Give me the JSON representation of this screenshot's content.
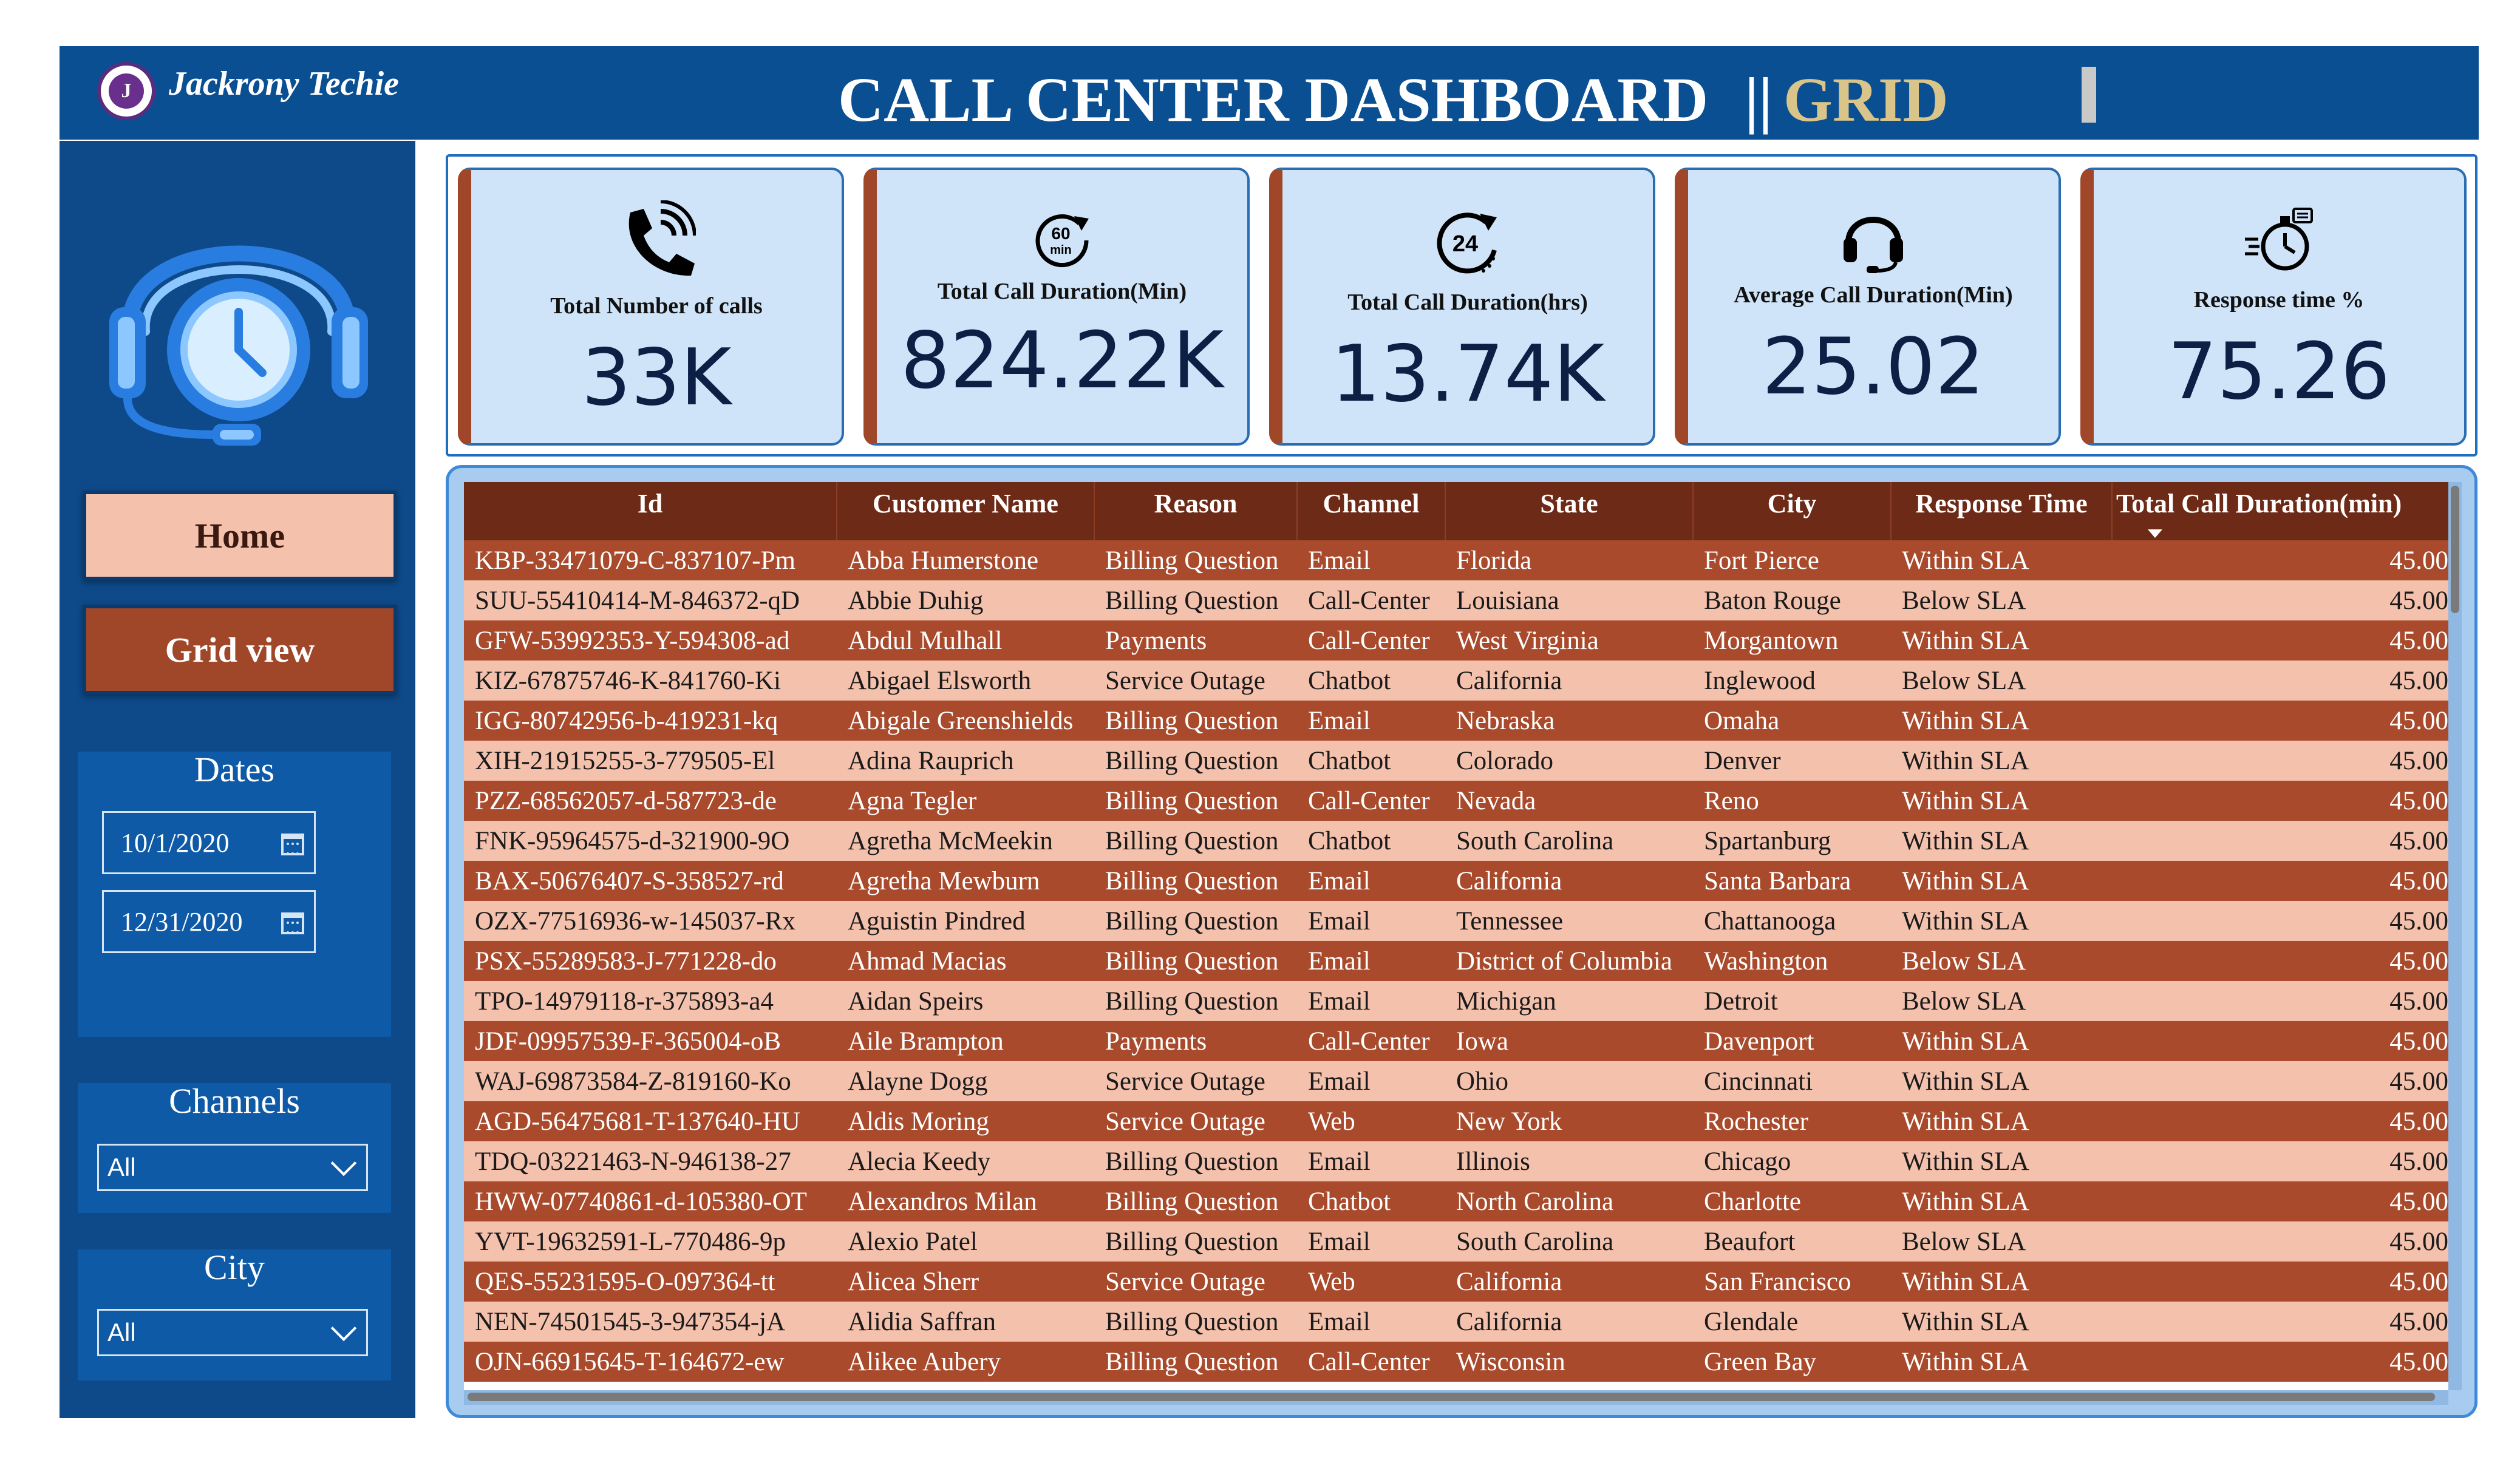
{
  "header": {
    "brand": "Jackrony Techie",
    "logo_letter": "J",
    "title": "CALL CENTER DASHBOARD",
    "separator": "||",
    "subtitle": "GRID"
  },
  "sidebar": {
    "nav": {
      "home_label": "Home",
      "grid_label": "Grid view"
    },
    "dates": {
      "title": "Dates",
      "start": "10/1/2020",
      "end": "12/31/2020"
    },
    "channels": {
      "title": "Channels",
      "value": "All"
    },
    "city": {
      "title": "City",
      "value": "All"
    }
  },
  "kpis": [
    {
      "label": "Total Number of calls",
      "value": "33K",
      "icon": "phone-ringing-icon"
    },
    {
      "label": "Total Call Duration(Min)",
      "value": "824.22K",
      "icon": "sixty-min-timer-icon"
    },
    {
      "label": "Total Call Duration(hrs)",
      "value": "13.74K",
      "icon": "twenty-four-hour-icon"
    },
    {
      "label": "Average Call Duration(Min)",
      "value": "25.02",
      "icon": "headset-icon"
    },
    {
      "label": "Response time %",
      "value": "75.26",
      "icon": "stopwatch-icon"
    }
  ],
  "table": {
    "columns": [
      "Id",
      "Customer Name",
      "Reason",
      "Channel",
      "State",
      "City",
      "Response Time",
      "Total Call Duration(min)"
    ],
    "rows": [
      [
        "KBP-33471079-C-837107-Pm",
        "Abba Humerstone",
        "Billing Question",
        "Email",
        "Florida",
        "Fort Pierce",
        "Within SLA",
        "45.00"
      ],
      [
        "SUU-55410414-M-846372-qD",
        "Abbie Duhig",
        "Billing Question",
        "Call-Center",
        "Louisiana",
        "Baton Rouge",
        "Below SLA",
        "45.00"
      ],
      [
        "GFW-53992353-Y-594308-ad",
        "Abdul Mulhall",
        "Payments",
        "Call-Center",
        "West Virginia",
        "Morgantown",
        "Within SLA",
        "45.00"
      ],
      [
        "KIZ-67875746-K-841760-Ki",
        "Abigael Elsworth",
        "Service Outage",
        "Chatbot",
        "California",
        "Inglewood",
        "Below SLA",
        "45.00"
      ],
      [
        "IGG-80742956-b-419231-kq",
        "Abigale Greenshields",
        "Billing Question",
        "Email",
        "Nebraska",
        "Omaha",
        "Within SLA",
        "45.00"
      ],
      [
        "XIH-21915255-3-779505-El",
        "Adina Rauprich",
        "Billing Question",
        "Chatbot",
        "Colorado",
        "Denver",
        "Within SLA",
        "45.00"
      ],
      [
        "PZZ-68562057-d-587723-de",
        "Agna Tegler",
        "Billing Question",
        "Call-Center",
        "Nevada",
        "Reno",
        "Within SLA",
        "45.00"
      ],
      [
        "FNK-95964575-d-321900-9O",
        "Agretha McMeekin",
        "Billing Question",
        "Chatbot",
        "South Carolina",
        "Spartanburg",
        "Within SLA",
        "45.00"
      ],
      [
        "BAX-50676407-S-358527-rd",
        "Agretha Mewburn",
        "Billing Question",
        "Email",
        "California",
        "Santa Barbara",
        "Within SLA",
        "45.00"
      ],
      [
        "OZX-77516936-w-145037-Rx",
        "Aguistin Pindred",
        "Billing Question",
        "Email",
        "Tennessee",
        "Chattanooga",
        "Within SLA",
        "45.00"
      ],
      [
        "PSX-55289583-J-771228-do",
        "Ahmad Macias",
        "Billing Question",
        "Email",
        "District of Columbia",
        "Washington",
        "Below SLA",
        "45.00"
      ],
      [
        "TPO-14979118-r-375893-a4",
        "Aidan Speirs",
        "Billing Question",
        "Email",
        "Michigan",
        "Detroit",
        "Below SLA",
        "45.00"
      ],
      [
        "JDF-09957539-F-365004-oB",
        "Aile Brampton",
        "Payments",
        "Call-Center",
        "Iowa",
        "Davenport",
        "Within SLA",
        "45.00"
      ],
      [
        "WAJ-69873584-Z-819160-Ko",
        "Alayne Dogg",
        "Service Outage",
        "Email",
        "Ohio",
        "Cincinnati",
        "Within SLA",
        "45.00"
      ],
      [
        "AGD-56475681-T-137640-HU",
        "Aldis Moring",
        "Service Outage",
        "Web",
        "New York",
        "Rochester",
        "Within SLA",
        "45.00"
      ],
      [
        "TDQ-03221463-N-946138-27",
        "Alecia Keedy",
        "Billing Question",
        "Email",
        "Illinois",
        "Chicago",
        "Within SLA",
        "45.00"
      ],
      [
        "HWW-07740861-d-105380-OT",
        "Alexandros Milan",
        "Billing Question",
        "Chatbot",
        "North Carolina",
        "Charlotte",
        "Within SLA",
        "45.00"
      ],
      [
        "YVT-19632591-L-770486-9p",
        "Alexio Patel",
        "Billing Question",
        "Email",
        "South Carolina",
        "Beaufort",
        "Below SLA",
        "45.00"
      ],
      [
        "QES-55231595-O-097364-tt",
        "Alicea Sherr",
        "Service Outage",
        "Web",
        "California",
        "San Francisco",
        "Within SLA",
        "45.00"
      ],
      [
        "NEN-74501545-3-947354-jA",
        "Alidia Saffran",
        "Billing Question",
        "Email",
        "California",
        "Glendale",
        "Within SLA",
        "45.00"
      ],
      [
        "OJN-66915645-T-164672-ew",
        "Alikee Aubery",
        "Billing Question",
        "Call-Center",
        "Wisconsin",
        "Green Bay",
        "Within SLA",
        "45.00"
      ]
    ]
  }
}
